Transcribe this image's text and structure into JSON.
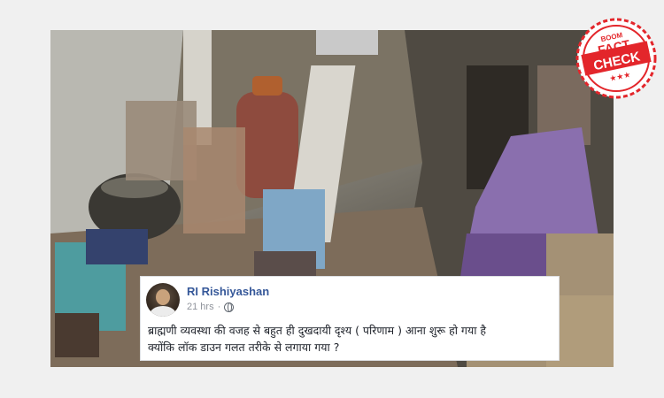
{
  "badge": {
    "brand": "BOOM",
    "line1": "FACT",
    "line2": "CHECK",
    "stars": "★★★",
    "color": "#e3262b"
  },
  "post": {
    "author": "RI Rishiyashan",
    "time": "21 hrs",
    "separator": "·",
    "privacy_icon": "globe-icon",
    "text_line1": "ब्राह्मणी व्यवस्था की वजह से बहुत ही दुखदायी दृश्य ( परिणाम ) आना शुरू हो गया है",
    "text_line2": "क्योंकि लॉक डाउन गलत तरीके से लगाया गया ?"
  },
  "colors": {
    "name_link": "#365899",
    "meta_text": "#90949c",
    "card_border": "#dddfe2"
  }
}
